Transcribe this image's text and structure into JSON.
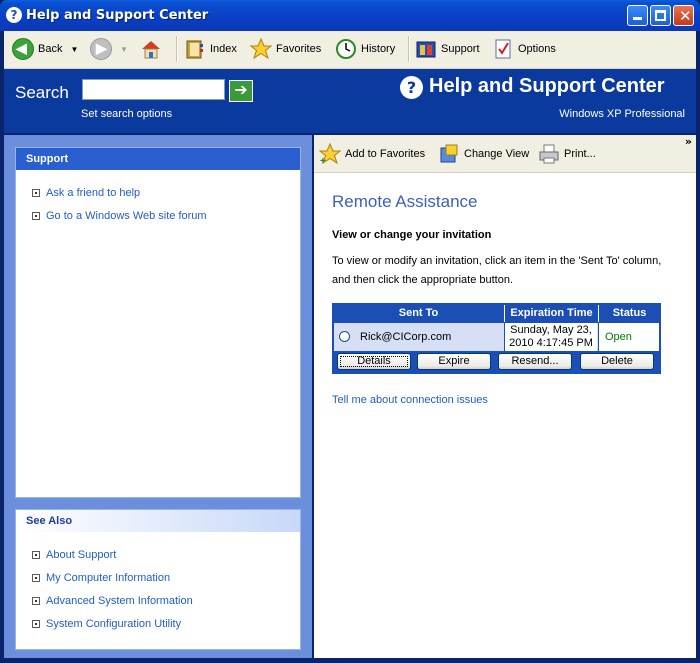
{
  "window": {
    "title": "Help and Support Center",
    "title_icon": "help-icon"
  },
  "toolbar": {
    "back_label": "Back",
    "index_label": "Index",
    "favorites_label": "Favorites",
    "history_label": "History",
    "support_label": "Support",
    "options_label": "Options"
  },
  "search": {
    "label": "Search",
    "value": "",
    "options_link": "Set search options"
  },
  "brand": {
    "title": "Help and Support Center",
    "subtitle": "Windows XP Professional"
  },
  "left_pane": {
    "support": {
      "heading": "Support",
      "links": [
        "Ask a friend to help",
        "Go to a Windows Web site forum"
      ]
    },
    "see_also": {
      "heading": "See Also",
      "links": [
        "About Support",
        "My Computer Information",
        "Advanced System Information",
        "System Configuration Utility"
      ]
    }
  },
  "right_toolbar": {
    "add_favorites": "Add to Favorites",
    "change_view": "Change View",
    "print": "Print..."
  },
  "content": {
    "title": "Remote Assistance",
    "subtitle": "View or change your invitation",
    "description": "To view or modify an invitation, click an item in the 'Sent To' column, and then click the appropriate button.",
    "table": {
      "headers": [
        "Sent To",
        "Expiration Time",
        "Status"
      ],
      "rows": [
        {
          "sent_to": "Rick@CICorp.com",
          "expiration_line1": "Sunday, May 23,",
          "expiration_line2": "2010 4:17:45 PM",
          "status": "Open"
        }
      ],
      "buttons": [
        "Details",
        "Expire",
        "Resend...",
        "Delete"
      ]
    },
    "connection_link": "Tell me about connection issues"
  },
  "colors": {
    "titlebar": "#0b3ec4",
    "search_band": "#0b3a9e",
    "left_pane": "#6b8fdc",
    "link": "#215dc6",
    "status_open": "#008000"
  }
}
